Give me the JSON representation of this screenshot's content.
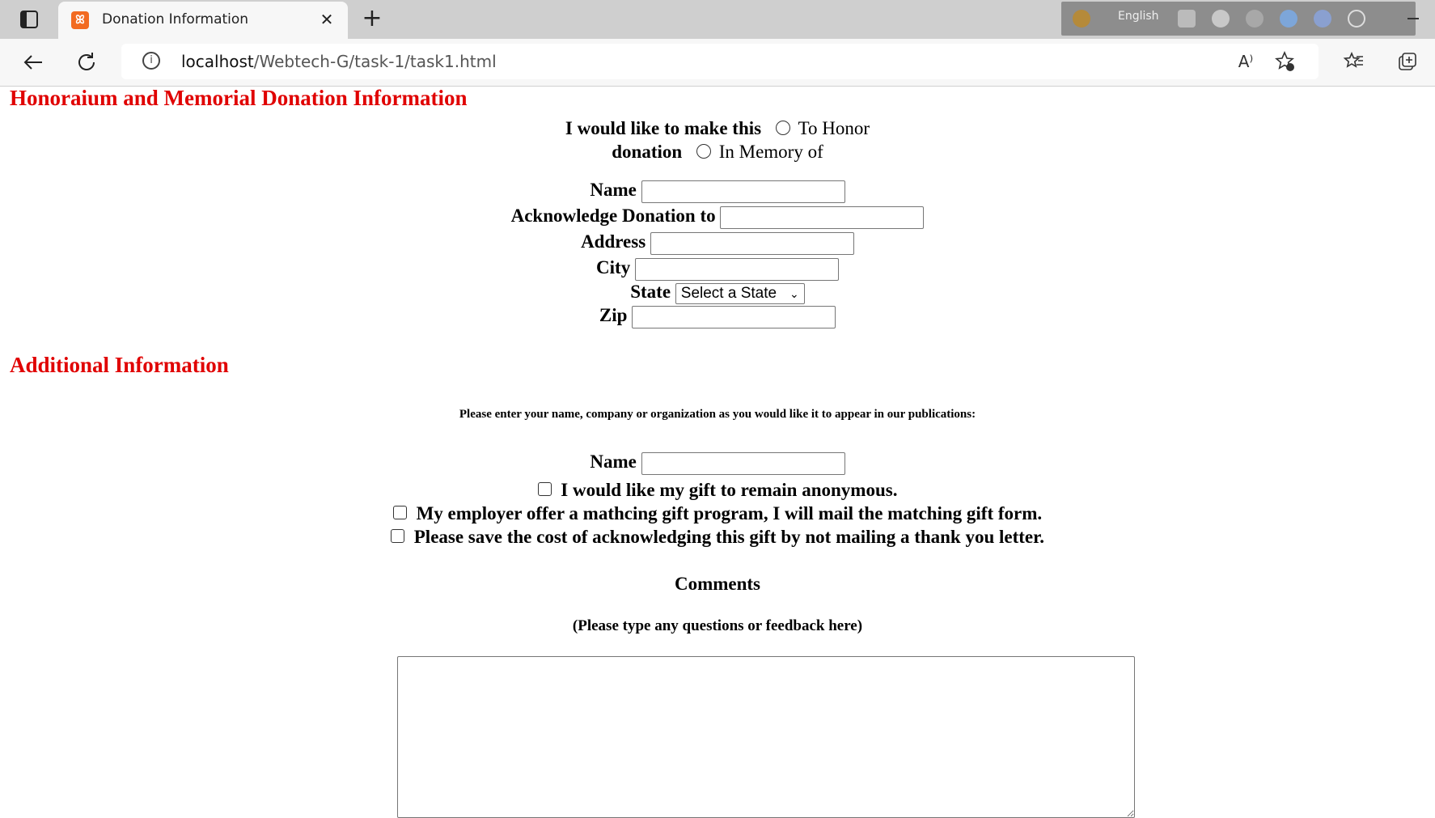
{
  "browser": {
    "tab_title": "Donation Information",
    "tab_close": "✕",
    "new_tab": "+",
    "extension_language": "English",
    "url_host": "localhost",
    "url_path": "/Webtech-G/task-1/task1.html",
    "icons": [
      "tab-actions-icon",
      "favicon-icon",
      "back-icon",
      "refresh-icon",
      "info-icon",
      "read-aloud-icon",
      "add-favorite-icon",
      "favorites-icon",
      "collections-icon"
    ],
    "read_aloud": "A⁾"
  },
  "form": {
    "heading1": "Honoraium and Memorial Donation Information",
    "donation_prefix_line1": "I would like to make this",
    "donation_prefix_line2": "donation",
    "option_honor": "To Honor",
    "option_memory": "In Memory of",
    "name_label": "Name",
    "acknowledge_label": "Acknowledge Donation to",
    "address_label": "Address",
    "city_label": "City",
    "state_label": "State",
    "state_selected": "Select a State",
    "zip_label": "Zip",
    "heading2": "Additional Information",
    "publication_note": "Please enter your name, company or organization as you would like it to appear in our publications:",
    "pub_name_label": "Name",
    "check_anonymous": "I would like my gift to remain anonymous.",
    "check_employer": "My employer offer a mathcing gift program, I will mail the matching gift form.",
    "check_no_mail": "Please save the cost of acknowledging this gift by not mailing a thank you letter.",
    "comments_label": "Comments",
    "comments_hint": "(Please type any questions or feedback here)"
  },
  "colors": {
    "heading": "#e00000",
    "tabbar": "#cfcfcf",
    "favicon": "#f26b21"
  }
}
